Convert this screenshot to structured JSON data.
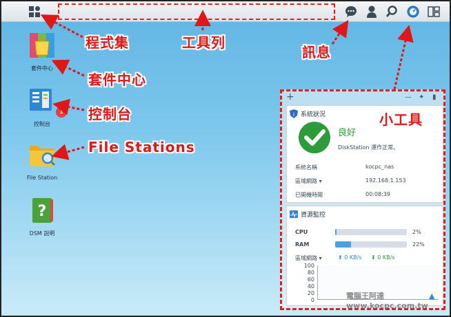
{
  "annotations": {
    "programs": "程式集",
    "toolbar": "工具列",
    "messages": "訊息",
    "package_center": "套件中心",
    "control_panel": "控制台",
    "file_stations": "File Stations",
    "widgets": "小工具"
  },
  "desktop": {
    "icons": [
      {
        "label": "套件中心"
      },
      {
        "label": "控制台",
        "badge": "1"
      },
      {
        "label": "File Station"
      },
      {
        "label": "DSM 說明"
      }
    ]
  },
  "system_status": {
    "title": "系統狀況",
    "health": "良好",
    "health_desc": "DiskStation 運作正常。",
    "rows": [
      {
        "label": "系統名稱",
        "value": "kocpc_nas"
      },
      {
        "label": "區域網路",
        "value": "192.168.1.153"
      },
      {
        "label": "已開機時間",
        "value": "00:08:39"
      }
    ]
  },
  "resource_monitor": {
    "title": "資源監控",
    "cpu": {
      "label": "CPU",
      "percent_text": "2%",
      "value": 2
    },
    "ram": {
      "label": "RAM",
      "percent_text": "22%",
      "value": 22
    },
    "lan_label": "區域網路",
    "upload": "0 KB/s",
    "download": "0 KB/s",
    "y_ticks": [
      "100",
      "80",
      "60",
      "40",
      "20",
      "0"
    ]
  },
  "colors": {
    "annotation": "#e01717",
    "status_ok": "#2c9b3a",
    "accent": "#4aa3e0"
  },
  "watermark": "電腦王阿達 www.kocpc.com.tw"
}
